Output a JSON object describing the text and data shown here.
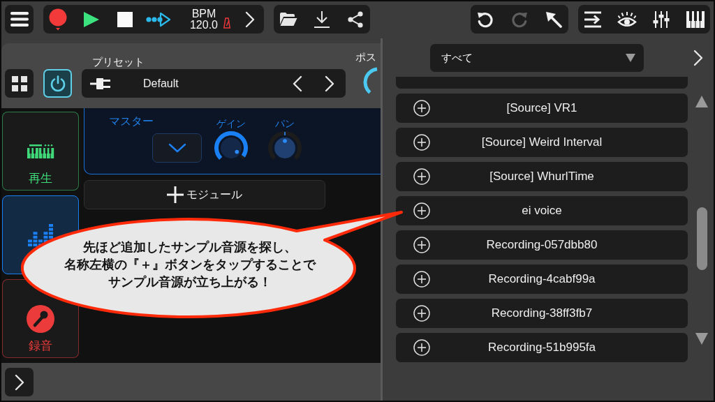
{
  "toolbar": {
    "tempo": {
      "label": "BPM",
      "value": "120.0"
    },
    "tools": [
      {
        "kind": "undo",
        "disabled": false
      },
      {
        "kind": "redo",
        "disabled": true
      },
      {
        "kind": "pointer",
        "disabled": false
      }
    ]
  },
  "preset": {
    "label": "プリセット",
    "value": "Default",
    "power_on": true
  },
  "post_knob": {
    "label": "ポス"
  },
  "side_tabs": [
    {
      "kind": "keyboard",
      "label": "再生",
      "color": "#3fd97a",
      "selected": false
    },
    {
      "kind": "meter",
      "color": "#1b7ff2",
      "selected": true
    },
    {
      "kind": "mic",
      "label": "録音",
      "color": "#ec3b3b",
      "selected": false
    }
  ],
  "master": {
    "title": "マスター",
    "knobs": [
      {
        "label": "ゲイン",
        "kind": "unipolar",
        "level": 0.96
      },
      {
        "label": "パン",
        "kind": "bipolar",
        "level": 0.5
      }
    ]
  },
  "add_module_button": {
    "label": "モジュール"
  },
  "browser": {
    "filter": "すべて",
    "rows": [
      {
        "kind": "clipped"
      },
      {
        "kind": "full",
        "label": "[Source] VR1"
      },
      {
        "kind": "full",
        "label": "[Source] Weird Interval"
      },
      {
        "kind": "full",
        "label": "[Source] WhurlTime"
      },
      {
        "kind": "full",
        "label": "ei voice"
      },
      {
        "kind": "full",
        "label": "Recording-057dbb80"
      },
      {
        "kind": "full",
        "label": "Recording-4cabf99a"
      },
      {
        "kind": "full",
        "label": "Recording-38ff3fb7"
      },
      {
        "kind": "full",
        "label": "Recording-51b995fa"
      }
    ]
  },
  "callout": {
    "lines": [
      "先ほど追加したサンプル音源を探し、",
      "名称左横の『＋』ボタンをタップすることで",
      "サンプル音源が立ち上がる！"
    ]
  }
}
